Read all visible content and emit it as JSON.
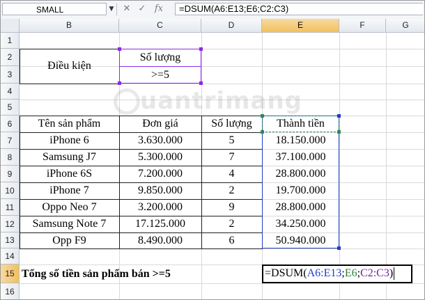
{
  "formula_bar": {
    "name_box": "SMALL",
    "cancel_glyph": "✕",
    "enter_glyph": "✓",
    "fx_label": "fx",
    "formula": "=DSUM(A6:E13;E6;C2:C3)"
  },
  "columns": [
    "B",
    "C",
    "D",
    "E",
    "F",
    "G"
  ],
  "rows": [
    "1",
    "2",
    "3",
    "4",
    "5",
    "6",
    "7",
    "8",
    "9",
    "10",
    "11",
    "12",
    "13",
    "14",
    "15",
    "16"
  ],
  "criteria": {
    "label": "Điều kiện",
    "header": "Số lượng",
    "value": ">=5"
  },
  "table": {
    "headers": [
      "Tên sản phẩm",
      "Đơn giá",
      "Số lượng",
      "Thành tiền"
    ],
    "rows": [
      [
        "iPhone 6",
        "3.630.000",
        "5",
        "18.150.000"
      ],
      [
        "Samsung J7",
        "5.300.000",
        "7",
        "37.100.000"
      ],
      [
        "iPhone 6S",
        "7.200.000",
        "4",
        "28.800.000"
      ],
      [
        "iPhone 7",
        "9.850.000",
        "2",
        "19.700.000"
      ],
      [
        "Oppo Neo 7",
        "3.200.000",
        "9",
        "28.800.000"
      ],
      [
        "Samsung Note 7",
        "17.125.000",
        "2",
        "34.250.000"
      ],
      [
        "Opp F9",
        "8.490.000",
        "6",
        "50.940.000"
      ]
    ]
  },
  "total_row": {
    "label": "Tổng số tiền sản phẩm bán >=5",
    "edit": {
      "prefix": "=DSUM(",
      "ref1": "A6:E13",
      "sep1": ";",
      "ref2": "E6",
      "sep2": ";",
      "ref3": "C2:C3",
      "suffix": ")"
    }
  },
  "watermark": "uantrimang",
  "colors": {
    "criteria_range": "#8a2be2",
    "field_ref": "#2e8b57",
    "database_range": "#1f3fbf",
    "active_header": "#f1c15f"
  }
}
